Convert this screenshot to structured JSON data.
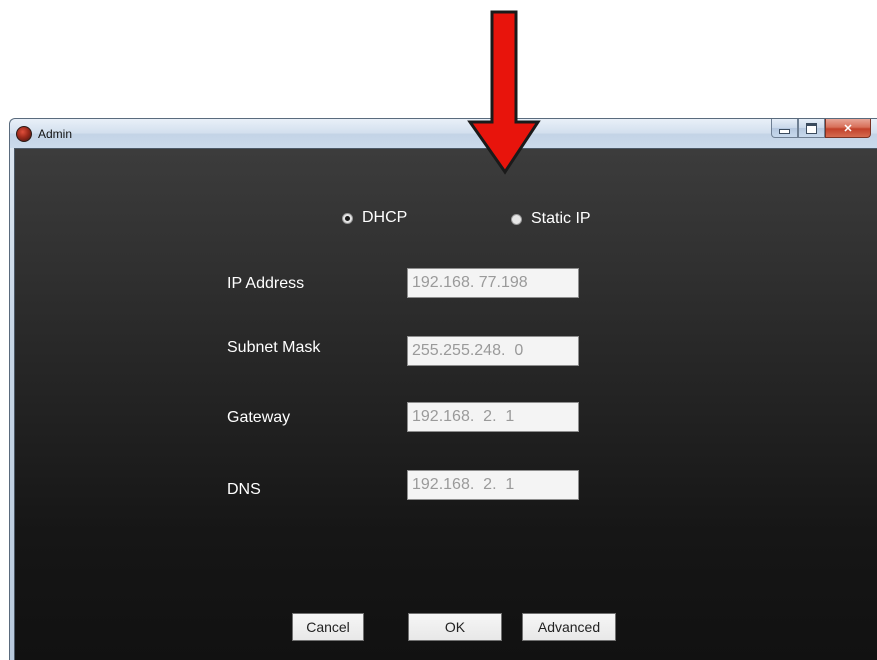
{
  "window": {
    "title": "Admin"
  },
  "network": {
    "mode_options": [
      {
        "label": "DHCP",
        "selected": true
      },
      {
        "label": "Static IP",
        "selected": false
      }
    ],
    "fields": [
      {
        "label": "IP Address",
        "value": "192.168. 77.198"
      },
      {
        "label": "Subnet Mask",
        "value": "255.255.248.  0"
      },
      {
        "label": "Gateway",
        "value": "192.168.  2.  1"
      },
      {
        "label": "DNS",
        "value": "192.168.  2.  1"
      }
    ]
  },
  "buttons": {
    "cancel": "Cancel",
    "ok": "OK",
    "advanced": "Advanced"
  },
  "colors": {
    "annotation_arrow": "#e8140c",
    "dialog_background": "#1c1c1c"
  },
  "icons": [
    "app-icon",
    "minimize-icon",
    "maximize-icon",
    "close-icon",
    "annotation-arrow-icon"
  ]
}
